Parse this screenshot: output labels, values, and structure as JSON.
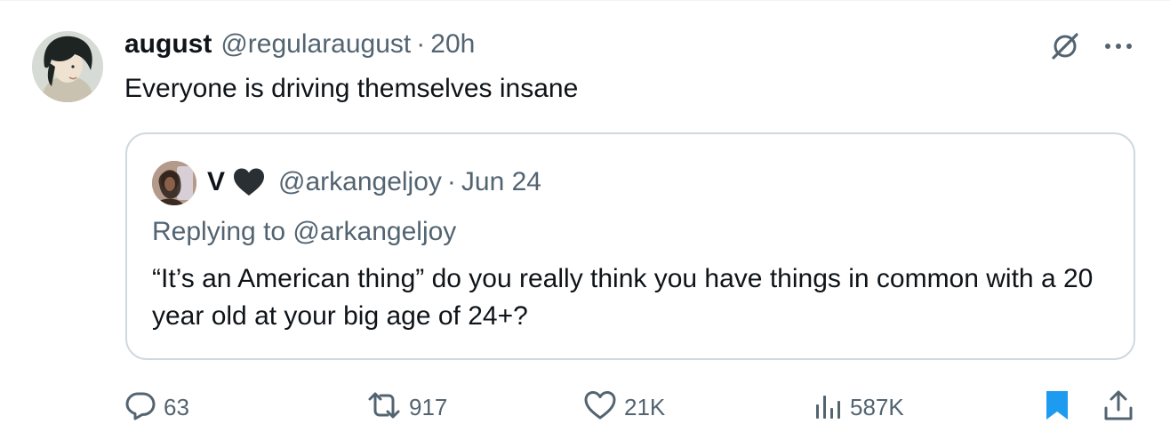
{
  "post": {
    "author_name": "august",
    "author_handle": "@regularaugust",
    "separator": "·",
    "time": "20h",
    "text": "Everyone is driving themselves insane"
  },
  "quoted": {
    "author_name": "V",
    "author_handle": "@arkangeljoy",
    "separator": "·",
    "time": "Jun 24",
    "replying_to": "Replying to @arkangeljoy",
    "text": "“It’s an American thing” do you really think you have things in common with a 20 year old at your big age of 24+?"
  },
  "actions": {
    "replies": "63",
    "reposts": "917",
    "likes": "21K",
    "views": "587K"
  },
  "icons": {
    "reply": "speech-bubble-icon",
    "repost": "repost-arrows-icon",
    "like": "heart-outline-icon",
    "views": "bar-chart-icon",
    "bookmark": "bookmark-filled-icon",
    "share": "share-upload-icon",
    "grok": "grok-slash-icon",
    "more": "more-dots-icon"
  },
  "colors": {
    "text": "#0f1419",
    "secondary": "#536471",
    "border": "#cfd9de",
    "bookmark": "#1d9bf0"
  }
}
